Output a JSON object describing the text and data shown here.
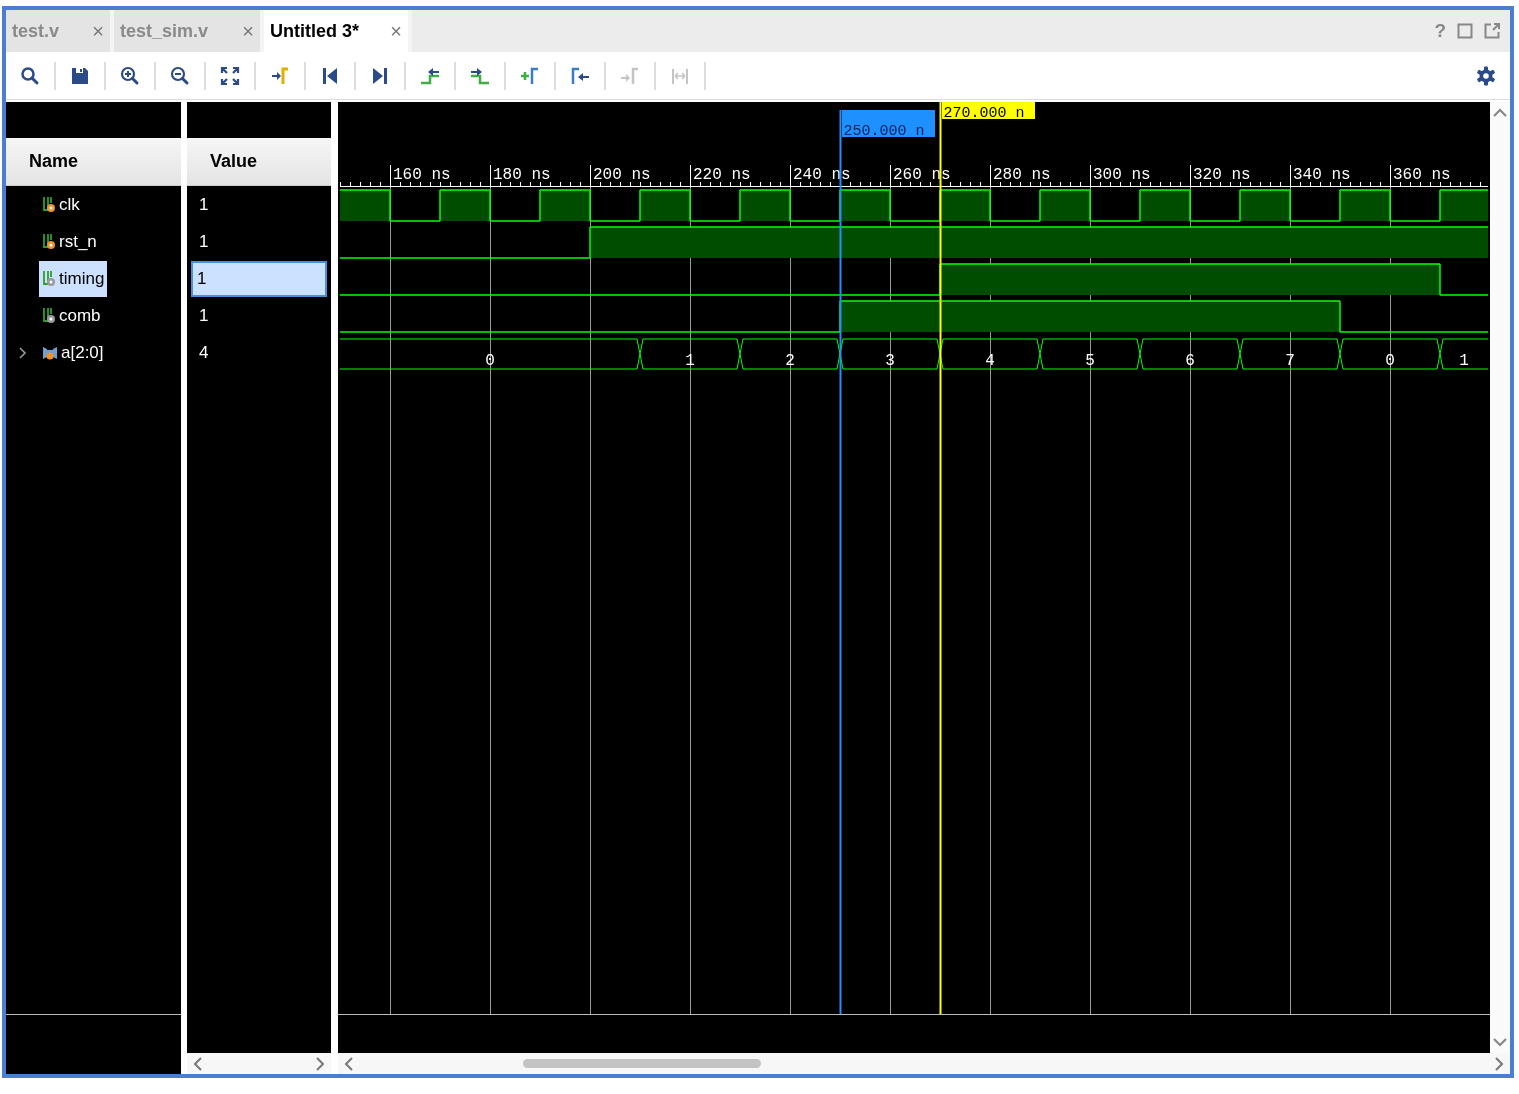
{
  "tabs": [
    {
      "label": "test.v",
      "close": "×",
      "selected": false
    },
    {
      "label": "test_sim.v",
      "close": "×",
      "selected": false
    },
    {
      "label": "Untitled 3*",
      "close": "×",
      "selected": true
    }
  ],
  "window_controls": {
    "help": "?"
  },
  "toolbar": [
    {
      "kind": "search",
      "disabled": false
    },
    {
      "kind": "save",
      "disabled": false
    },
    {
      "kind": "zoom-in",
      "disabled": false
    },
    {
      "kind": "zoom-out",
      "disabled": false
    },
    {
      "kind": "zoom-fit",
      "disabled": false
    },
    {
      "kind": "goto-cursor",
      "disabled": false
    },
    {
      "kind": "goto-start",
      "disabled": false
    },
    {
      "kind": "goto-end",
      "disabled": false
    },
    {
      "kind": "prev-transition",
      "disabled": false
    },
    {
      "kind": "next-transition",
      "disabled": false
    },
    {
      "kind": "add-marker",
      "disabled": false
    },
    {
      "kind": "prev-marker",
      "disabled": false
    },
    {
      "kind": "next-marker",
      "disabled": true
    },
    {
      "kind": "swap-cursors",
      "disabled": true
    }
  ],
  "columns": {
    "name": "Name",
    "value": "Value"
  },
  "signals": [
    {
      "name": "clk",
      "kind": "port",
      "value": "1",
      "selected": false
    },
    {
      "name": "rst_n",
      "kind": "port",
      "value": "1",
      "selected": false
    },
    {
      "name": "timing",
      "kind": "internal",
      "value": "1",
      "selected": true
    },
    {
      "name": "comb",
      "kind": "internal",
      "value": "1",
      "selected": false
    },
    {
      "name": "a[2:0]",
      "kind": "bus",
      "value": "4",
      "selected": false,
      "expanded": false
    }
  ],
  "waveform": {
    "ticks": [
      "160 ns",
      "180 ns",
      "200 ns",
      "220 ns",
      "240 ns",
      "260 ns",
      "280 ns",
      "300 ns",
      "320 ns",
      "340 ns",
      "360 ns"
    ],
    "traces": [
      {
        "kind": "bit",
        "high": [
          true,
          false,
          true,
          false,
          true,
          false,
          true,
          false,
          true,
          false,
          true,
          false,
          true,
          false,
          true,
          false,
          true,
          false,
          true,
          false,
          true,
          false,
          true
        ]
      },
      {
        "kind": "bit",
        "high": [
          false,
          false,
          false,
          false,
          false,
          true,
          true,
          true,
          true,
          true,
          true,
          true,
          true,
          true,
          true,
          true,
          true,
          true,
          true,
          true,
          true,
          true,
          true
        ]
      },
      {
        "kind": "bit",
        "high": [
          false,
          false,
          false,
          false,
          false,
          false,
          false,
          false,
          false,
          false,
          false,
          false,
          true,
          true,
          true,
          true,
          true,
          true,
          true,
          true,
          true,
          true,
          false
        ]
      },
      {
        "kind": "bit",
        "high": [
          false,
          false,
          false,
          false,
          false,
          false,
          false,
          false,
          false,
          false,
          true,
          true,
          true,
          true,
          true,
          true,
          true,
          true,
          true,
          true,
          false,
          false,
          false
        ]
      },
      {
        "kind": "bus",
        "change": [
          false,
          false,
          false,
          false,
          false,
          true,
          false,
          true,
          false,
          true,
          false,
          true,
          false,
          true,
          false,
          true,
          false,
          true,
          false,
          true,
          false,
          true
        ],
        "labels": [
          "0",
          "1",
          "2",
          "3",
          "4",
          "5",
          "6",
          "7",
          "0",
          "1"
        ]
      }
    ],
    "cursors": [
      {
        "label": "250.000 n",
        "color": "#1e90ff",
        "level": 0.4355
      },
      {
        "label": "270.000 n",
        "color": "#ffff00",
        "level": 0.5226
      }
    ]
  }
}
